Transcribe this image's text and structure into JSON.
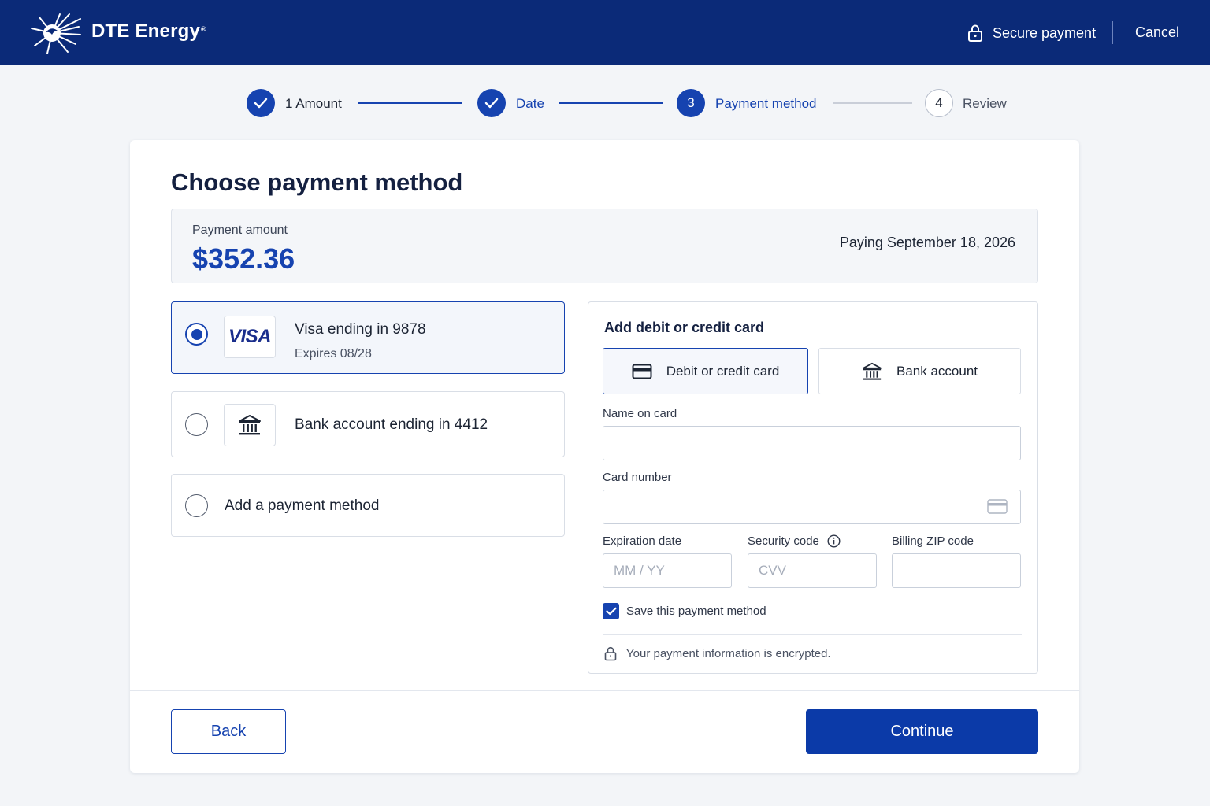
{
  "header": {
    "brand": "DTE Energy",
    "brand_mark": "®",
    "secure_label": "Secure payment",
    "cancel_label": "Cancel",
    "icons": {
      "logo": "dte-logo-icon",
      "lock": "lock-icon"
    },
    "bg_color": "#0b2a78"
  },
  "stepper": {
    "steps": [
      {
        "label": "1 Amount",
        "status": "complete"
      },
      {
        "label": "Date",
        "status": "complete"
      },
      {
        "number": "3",
        "label": "Payment method",
        "status": "current"
      },
      {
        "number": "4",
        "label": "Review",
        "status": "upcoming"
      }
    ]
  },
  "page": {
    "title": "Choose payment method"
  },
  "summary": {
    "amount_label": "Payment amount",
    "amount": "$352.36",
    "paying_text": "Paying September 18, 2026"
  },
  "payment_methods": [
    {
      "brand": "VISA",
      "title": "Visa ending in 9878",
      "subtitle": "Expires 08/28",
      "selected": true,
      "icon": "visa-logo"
    },
    {
      "title": "Bank account ending in 4412",
      "selected": false,
      "icon": "bank-icon"
    },
    {
      "title": "Add a payment method",
      "selected": false
    }
  ],
  "add_card": {
    "title": "Add debit or credit card",
    "tabs": [
      {
        "label": "Debit or credit card",
        "icon": "credit-card-icon",
        "active": true
      },
      {
        "label": "Bank account",
        "icon": "bank-icon",
        "active": false
      }
    ],
    "fields": {
      "name_label": "Name on card",
      "name_value": "",
      "number_label": "Card number",
      "number_value": "",
      "exp_label": "Expiration date",
      "exp_placeholder": "MM / YY",
      "cvv_label": "Security code",
      "cvv_placeholder": "CVV",
      "zip_label": "Billing ZIP code",
      "zip_value": ""
    },
    "save_label": "Save this payment method",
    "save_checked": true,
    "encrypted_note": "Your payment information is encrypted."
  },
  "actions": {
    "back_label": "Back",
    "continue_label": "Continue"
  },
  "colors": {
    "primary": "#1643b0",
    "inactive_line": "#c9ced8"
  }
}
